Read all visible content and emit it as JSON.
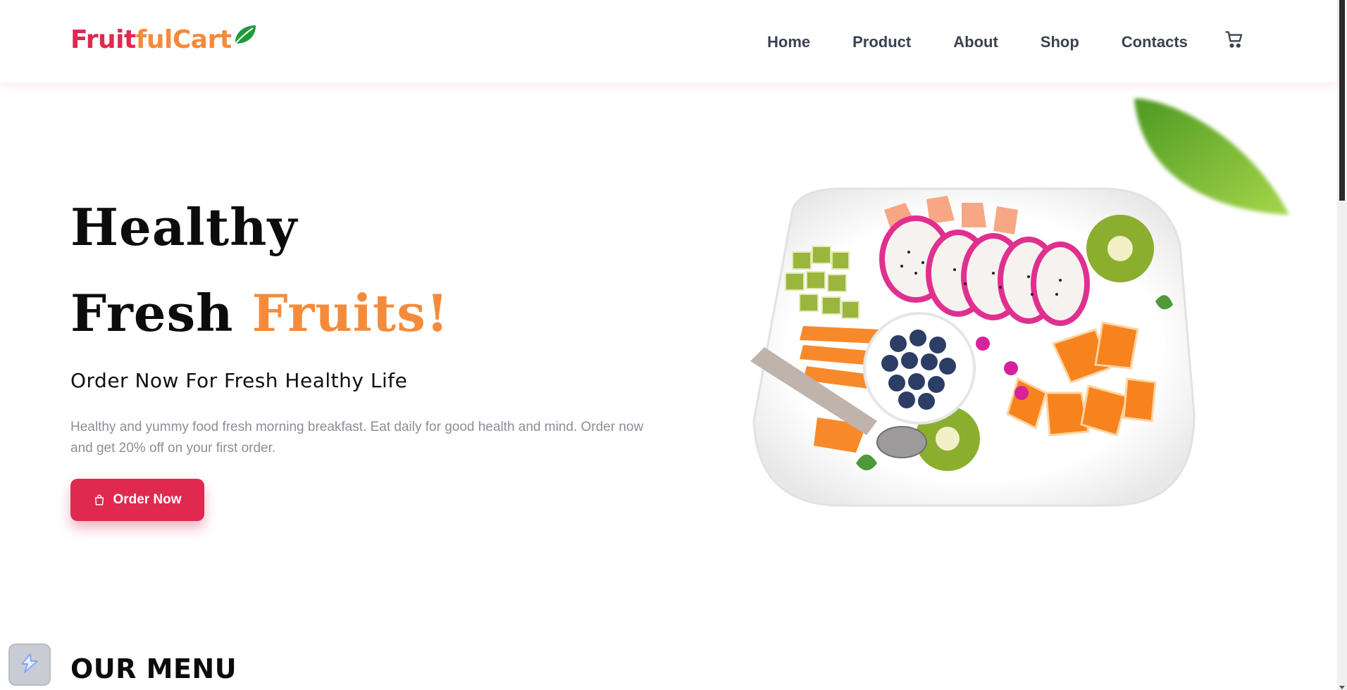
{
  "header": {
    "logo": {
      "part1": "Fruit",
      "part2": "fulCart"
    },
    "nav": [
      "Home",
      "Product",
      "About",
      "Shop",
      "Contacts"
    ],
    "cart_icon": "cart-icon"
  },
  "hero": {
    "line1": "Healthy",
    "line2_prefix": "Fresh ",
    "line2_accent": "Fruits!",
    "subtitle": "Order Now For Fresh Healthy Life",
    "description": "Healthy and yummy food fresh morning breakfast. Eat daily for good health and mind. Order now and get 20% off on your first order.",
    "button_label": "Order Now",
    "button_icon": "shopping-bag-icon"
  },
  "menu": {
    "title": "OUR MENU"
  },
  "colors": {
    "primary": "#e0294f",
    "accent": "#f58b3a",
    "nav_text": "#3a4150",
    "muted": "#8a8f98"
  }
}
